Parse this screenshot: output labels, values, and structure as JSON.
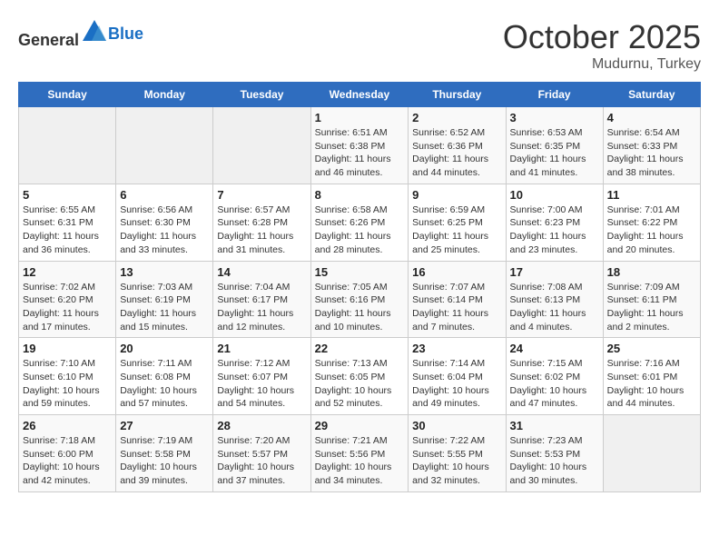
{
  "header": {
    "logo_general": "General",
    "logo_blue": "Blue",
    "month_title": "October 2025",
    "location": "Mudurnu, Turkey"
  },
  "days_of_week": [
    "Sunday",
    "Monday",
    "Tuesday",
    "Wednesday",
    "Thursday",
    "Friday",
    "Saturday"
  ],
  "weeks": [
    [
      {
        "day": "",
        "info": ""
      },
      {
        "day": "",
        "info": ""
      },
      {
        "day": "",
        "info": ""
      },
      {
        "day": "1",
        "info": "Sunrise: 6:51 AM\nSunset: 6:38 PM\nDaylight: 11 hours\nand 46 minutes."
      },
      {
        "day": "2",
        "info": "Sunrise: 6:52 AM\nSunset: 6:36 PM\nDaylight: 11 hours\nand 44 minutes."
      },
      {
        "day": "3",
        "info": "Sunrise: 6:53 AM\nSunset: 6:35 PM\nDaylight: 11 hours\nand 41 minutes."
      },
      {
        "day": "4",
        "info": "Sunrise: 6:54 AM\nSunset: 6:33 PM\nDaylight: 11 hours\nand 38 minutes."
      }
    ],
    [
      {
        "day": "5",
        "info": "Sunrise: 6:55 AM\nSunset: 6:31 PM\nDaylight: 11 hours\nand 36 minutes."
      },
      {
        "day": "6",
        "info": "Sunrise: 6:56 AM\nSunset: 6:30 PM\nDaylight: 11 hours\nand 33 minutes."
      },
      {
        "day": "7",
        "info": "Sunrise: 6:57 AM\nSunset: 6:28 PM\nDaylight: 11 hours\nand 31 minutes."
      },
      {
        "day": "8",
        "info": "Sunrise: 6:58 AM\nSunset: 6:26 PM\nDaylight: 11 hours\nand 28 minutes."
      },
      {
        "day": "9",
        "info": "Sunrise: 6:59 AM\nSunset: 6:25 PM\nDaylight: 11 hours\nand 25 minutes."
      },
      {
        "day": "10",
        "info": "Sunrise: 7:00 AM\nSunset: 6:23 PM\nDaylight: 11 hours\nand 23 minutes."
      },
      {
        "day": "11",
        "info": "Sunrise: 7:01 AM\nSunset: 6:22 PM\nDaylight: 11 hours\nand 20 minutes."
      }
    ],
    [
      {
        "day": "12",
        "info": "Sunrise: 7:02 AM\nSunset: 6:20 PM\nDaylight: 11 hours\nand 17 minutes."
      },
      {
        "day": "13",
        "info": "Sunrise: 7:03 AM\nSunset: 6:19 PM\nDaylight: 11 hours\nand 15 minutes."
      },
      {
        "day": "14",
        "info": "Sunrise: 7:04 AM\nSunset: 6:17 PM\nDaylight: 11 hours\nand 12 minutes."
      },
      {
        "day": "15",
        "info": "Sunrise: 7:05 AM\nSunset: 6:16 PM\nDaylight: 11 hours\nand 10 minutes."
      },
      {
        "day": "16",
        "info": "Sunrise: 7:07 AM\nSunset: 6:14 PM\nDaylight: 11 hours\nand 7 minutes."
      },
      {
        "day": "17",
        "info": "Sunrise: 7:08 AM\nSunset: 6:13 PM\nDaylight: 11 hours\nand 4 minutes."
      },
      {
        "day": "18",
        "info": "Sunrise: 7:09 AM\nSunset: 6:11 PM\nDaylight: 11 hours\nand 2 minutes."
      }
    ],
    [
      {
        "day": "19",
        "info": "Sunrise: 7:10 AM\nSunset: 6:10 PM\nDaylight: 10 hours\nand 59 minutes."
      },
      {
        "day": "20",
        "info": "Sunrise: 7:11 AM\nSunset: 6:08 PM\nDaylight: 10 hours\nand 57 minutes."
      },
      {
        "day": "21",
        "info": "Sunrise: 7:12 AM\nSunset: 6:07 PM\nDaylight: 10 hours\nand 54 minutes."
      },
      {
        "day": "22",
        "info": "Sunrise: 7:13 AM\nSunset: 6:05 PM\nDaylight: 10 hours\nand 52 minutes."
      },
      {
        "day": "23",
        "info": "Sunrise: 7:14 AM\nSunset: 6:04 PM\nDaylight: 10 hours\nand 49 minutes."
      },
      {
        "day": "24",
        "info": "Sunrise: 7:15 AM\nSunset: 6:02 PM\nDaylight: 10 hours\nand 47 minutes."
      },
      {
        "day": "25",
        "info": "Sunrise: 7:16 AM\nSunset: 6:01 PM\nDaylight: 10 hours\nand 44 minutes."
      }
    ],
    [
      {
        "day": "26",
        "info": "Sunrise: 7:18 AM\nSunset: 6:00 PM\nDaylight: 10 hours\nand 42 minutes."
      },
      {
        "day": "27",
        "info": "Sunrise: 7:19 AM\nSunset: 5:58 PM\nDaylight: 10 hours\nand 39 minutes."
      },
      {
        "day": "28",
        "info": "Sunrise: 7:20 AM\nSunset: 5:57 PM\nDaylight: 10 hours\nand 37 minutes."
      },
      {
        "day": "29",
        "info": "Sunrise: 7:21 AM\nSunset: 5:56 PM\nDaylight: 10 hours\nand 34 minutes."
      },
      {
        "day": "30",
        "info": "Sunrise: 7:22 AM\nSunset: 5:55 PM\nDaylight: 10 hours\nand 32 minutes."
      },
      {
        "day": "31",
        "info": "Sunrise: 7:23 AM\nSunset: 5:53 PM\nDaylight: 10 hours\nand 30 minutes."
      },
      {
        "day": "",
        "info": ""
      }
    ]
  ]
}
